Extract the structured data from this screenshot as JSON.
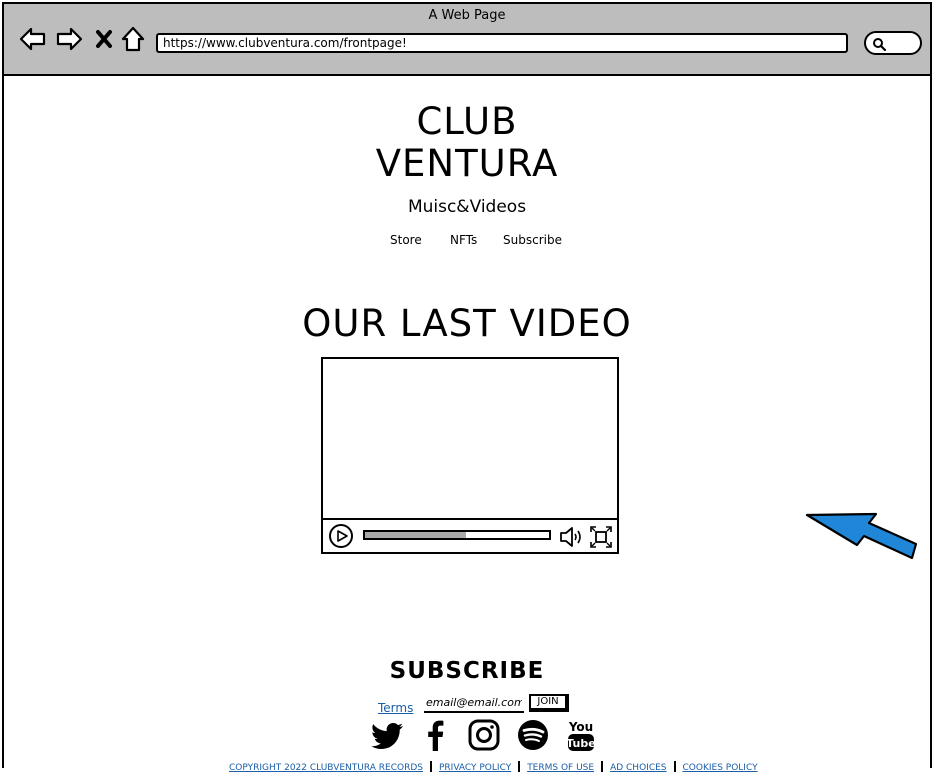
{
  "window": {
    "title": "A Web Page"
  },
  "browser": {
    "url": "https://www.clubventura.com/frontpage!",
    "icons": [
      "back-arrow-icon",
      "forward-arrow-icon",
      "close-x-icon",
      "home-icon",
      "search-icon"
    ]
  },
  "header": {
    "brand_line1": "CLUB",
    "brand_line2": "VENTURA",
    "tagline": "Muisc&Videos",
    "menu": [
      "Store",
      "NFTs",
      "Subscribe"
    ]
  },
  "video_section": {
    "title": "OUR LAST VIDEO",
    "progress": 0.55,
    "icons": [
      "play-icon",
      "volume-icon",
      "fullscreen-icon"
    ]
  },
  "subscribe": {
    "title": "SUBSCRIBE",
    "terms_link": "Terms",
    "email_value": "email@email.com",
    "join_label": "JOIN"
  },
  "social_icons": [
    "twitter-icon",
    "facebook-icon",
    "instagram-icon",
    "spotify-icon",
    "youtube-icon"
  ],
  "footer": {
    "links": [
      "COPYRIGHT 2022 CLUBVENTURA RECORDS",
      "PRIVACY POLICY",
      "TERMS OF USE",
      "AD CHOICES",
      "COOKIES POLICY"
    ]
  },
  "colors": {
    "chrome": "#bdbdbd",
    "link": "#1a5ea8",
    "arrow": "#1f86d8"
  }
}
